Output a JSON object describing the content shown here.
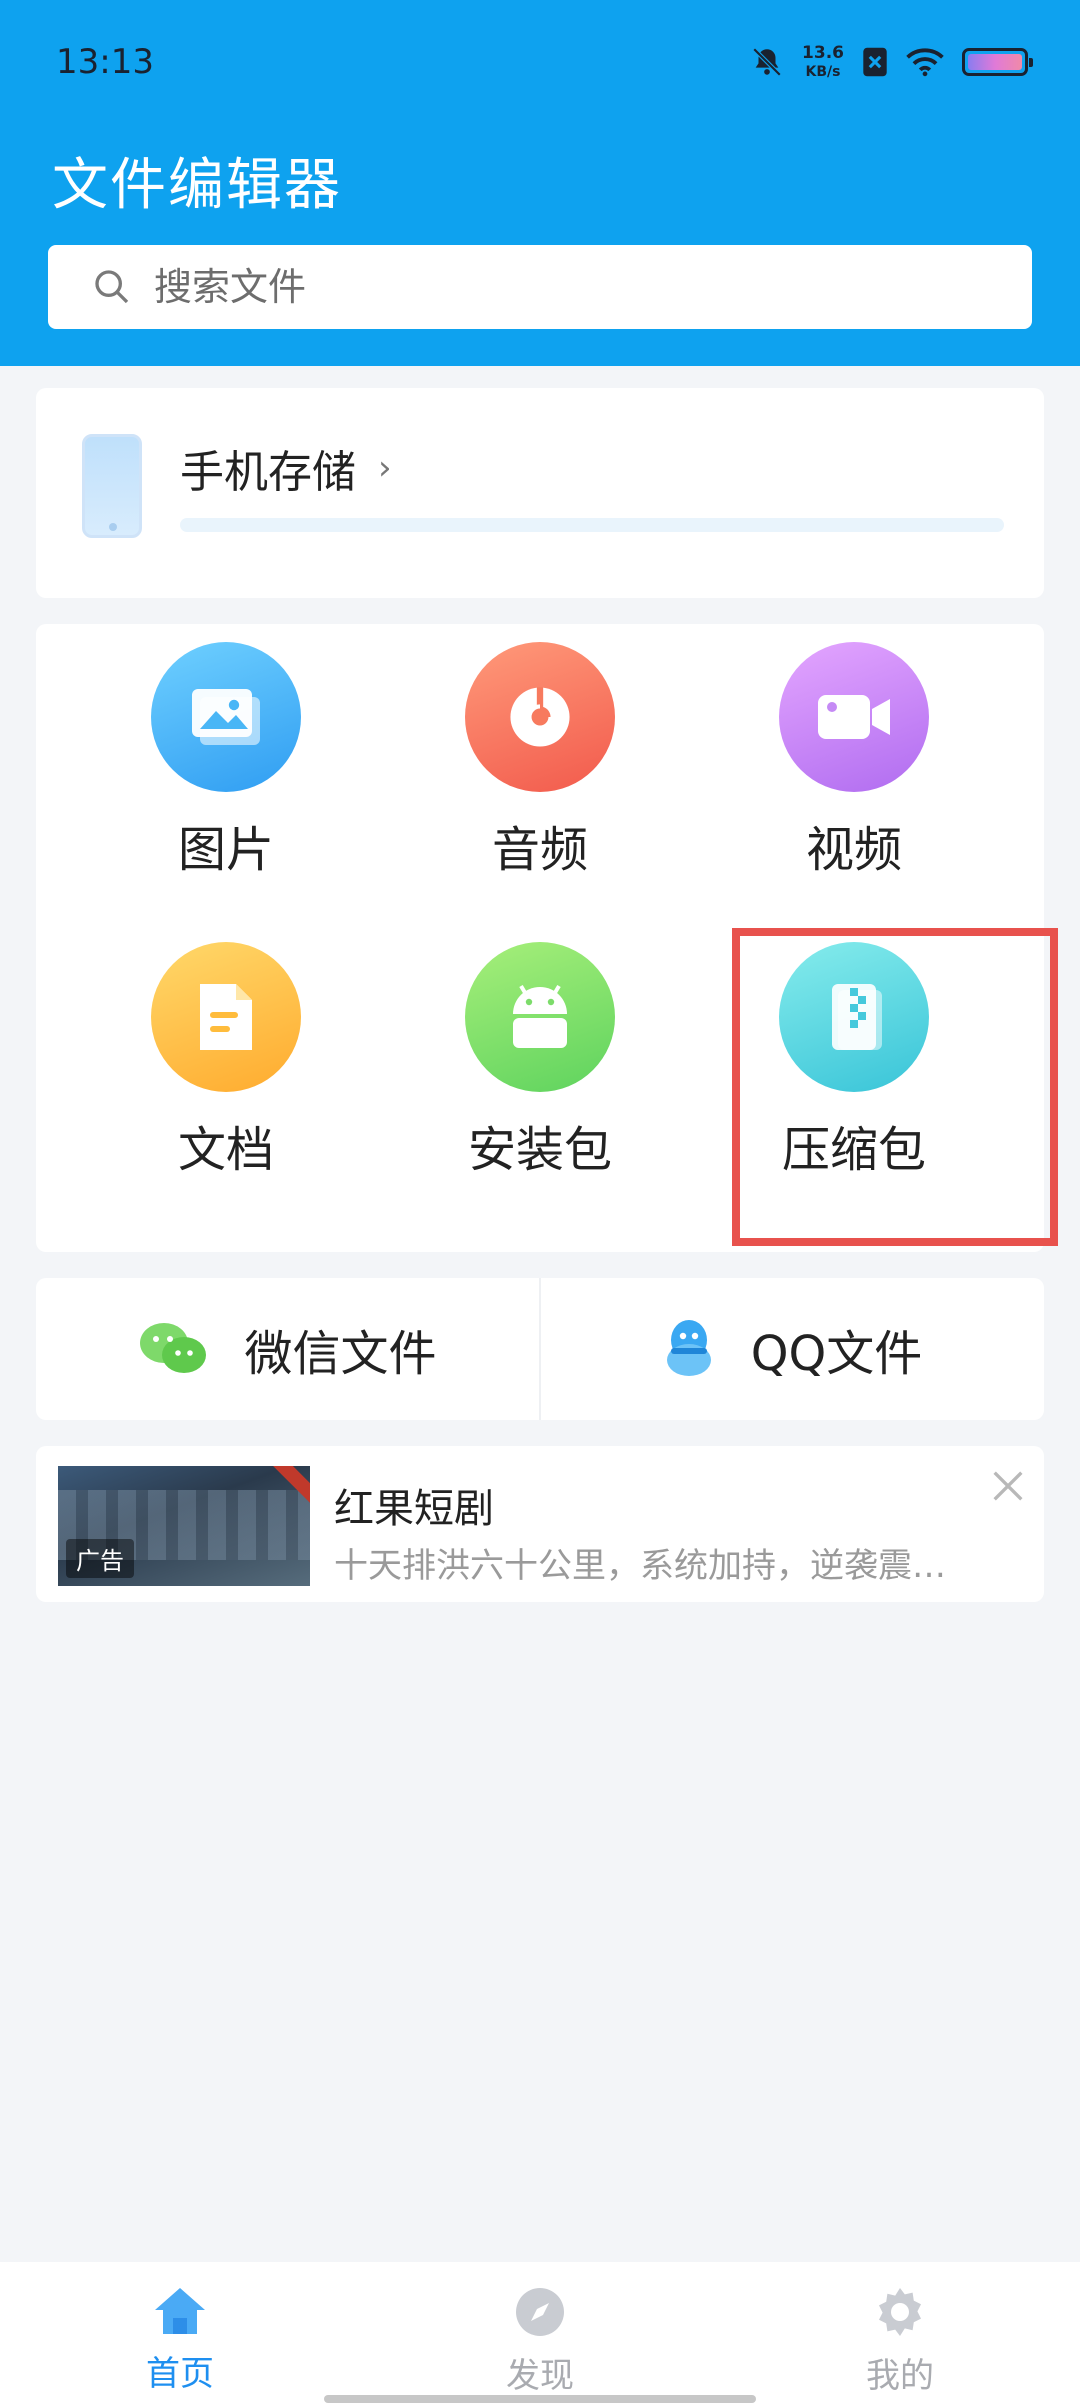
{
  "status_bar": {
    "time": "13:13",
    "net_speed": "13.6",
    "net_unit": "KB/s"
  },
  "header": {
    "title": "文件编辑器"
  },
  "search": {
    "placeholder": "搜索文件"
  },
  "storage": {
    "label": "手机存储",
    "chevron": "›",
    "used_fraction": 0.0
  },
  "categories": [
    {
      "label": "图片",
      "icon": "image-icon",
      "color_from": "#6fd0ff",
      "color_to": "#2f9df2"
    },
    {
      "label": "音频",
      "icon": "music-disc-icon",
      "color_from": "#ff9a7a",
      "color_to": "#f25a4c"
    },
    {
      "label": "视频",
      "icon": "video-camera-icon",
      "color_from": "#e4a6ff",
      "color_to": "#b06cf0"
    },
    {
      "label": "文档",
      "icon": "document-icon",
      "color_from": "#ffd86a",
      "color_to": "#ffab2e"
    },
    {
      "label": "安装包",
      "icon": "android-icon",
      "color_from": "#a7ef7a",
      "color_to": "#5ed35e"
    },
    {
      "label": "压缩包",
      "icon": "archive-zip-icon",
      "color_from": "#86ecec",
      "color_to": "#38c4d8"
    }
  ],
  "shortcuts": {
    "wechat_label": "微信文件",
    "qq_label": "QQ文件"
  },
  "ad": {
    "title": "红果短剧",
    "description": "十天排洪六十公里，系统加持，逆袭震…",
    "tag": "广告"
  },
  "bottom_nav": [
    {
      "label": "首页",
      "icon": "home-icon",
      "active": true
    },
    {
      "label": "发现",
      "icon": "compass-icon",
      "active": false
    },
    {
      "label": "我的",
      "icon": "gear-icon",
      "active": false
    }
  ],
  "colors": {
    "header_bg": "#0ea2ef",
    "highlight": "#e8524d",
    "active_nav": "#1e8ff0"
  }
}
